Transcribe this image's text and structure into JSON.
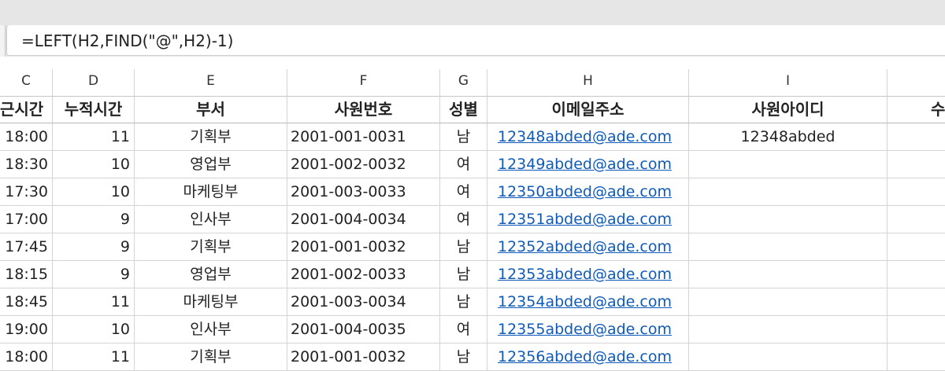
{
  "formula_bar": {
    "formula": "=LEFT(H2,FIND(\"@\",H2)-1)"
  },
  "columns": [
    "C",
    "D",
    "E",
    "F",
    "G",
    "H",
    "I"
  ],
  "table": {
    "headers": [
      "근시간",
      "누적시간",
      "부서",
      "사원번호",
      "성별",
      "이메일주소",
      "사원아이디",
      "수"
    ],
    "rows": [
      {
        "time": "18:00",
        "hours": "11",
        "dept": "기획부",
        "emp_no": "2001-001-0031",
        "gender": "남",
        "email": "12348abded@ade.com",
        "id": "12348abded"
      },
      {
        "time": "18:30",
        "hours": "10",
        "dept": "영업부",
        "emp_no": "2001-002-0032",
        "gender": "여",
        "email": "12349abded@ade.com",
        "id": ""
      },
      {
        "time": "17:30",
        "hours": "10",
        "dept": "마케팅부",
        "emp_no": "2001-003-0033",
        "gender": "여",
        "email": "12350abded@ade.com",
        "id": ""
      },
      {
        "time": "17:00",
        "hours": "9",
        "dept": "인사부",
        "emp_no": "2001-004-0034",
        "gender": "여",
        "email": "12351abded@ade.com",
        "id": ""
      },
      {
        "time": "17:45",
        "hours": "9",
        "dept": "기획부",
        "emp_no": "2001-001-0032",
        "gender": "남",
        "email": "12352abded@ade.com",
        "id": ""
      },
      {
        "time": "18:15",
        "hours": "9",
        "dept": "영업부",
        "emp_no": "2001-002-0033",
        "gender": "남",
        "email": "12353abded@ade.com",
        "id": ""
      },
      {
        "time": "18:45",
        "hours": "11",
        "dept": "마케팅부",
        "emp_no": "2001-003-0034",
        "gender": "남",
        "email": "12354abded@ade.com",
        "id": ""
      },
      {
        "time": "19:00",
        "hours": "10",
        "dept": "인사부",
        "emp_no": "2001-004-0035",
        "gender": "여",
        "email": "12355abded@ade.com",
        "id": ""
      },
      {
        "time": "18:00",
        "hours": "11",
        "dept": "기획부",
        "emp_no": "2001-001-0032",
        "gender": "남",
        "email": "12356abded@ade.com",
        "id": ""
      }
    ]
  },
  "colors": {
    "link": "#0f5ab8",
    "gridline": "#d4d4d4",
    "chrome": "#e6e6e6"
  }
}
